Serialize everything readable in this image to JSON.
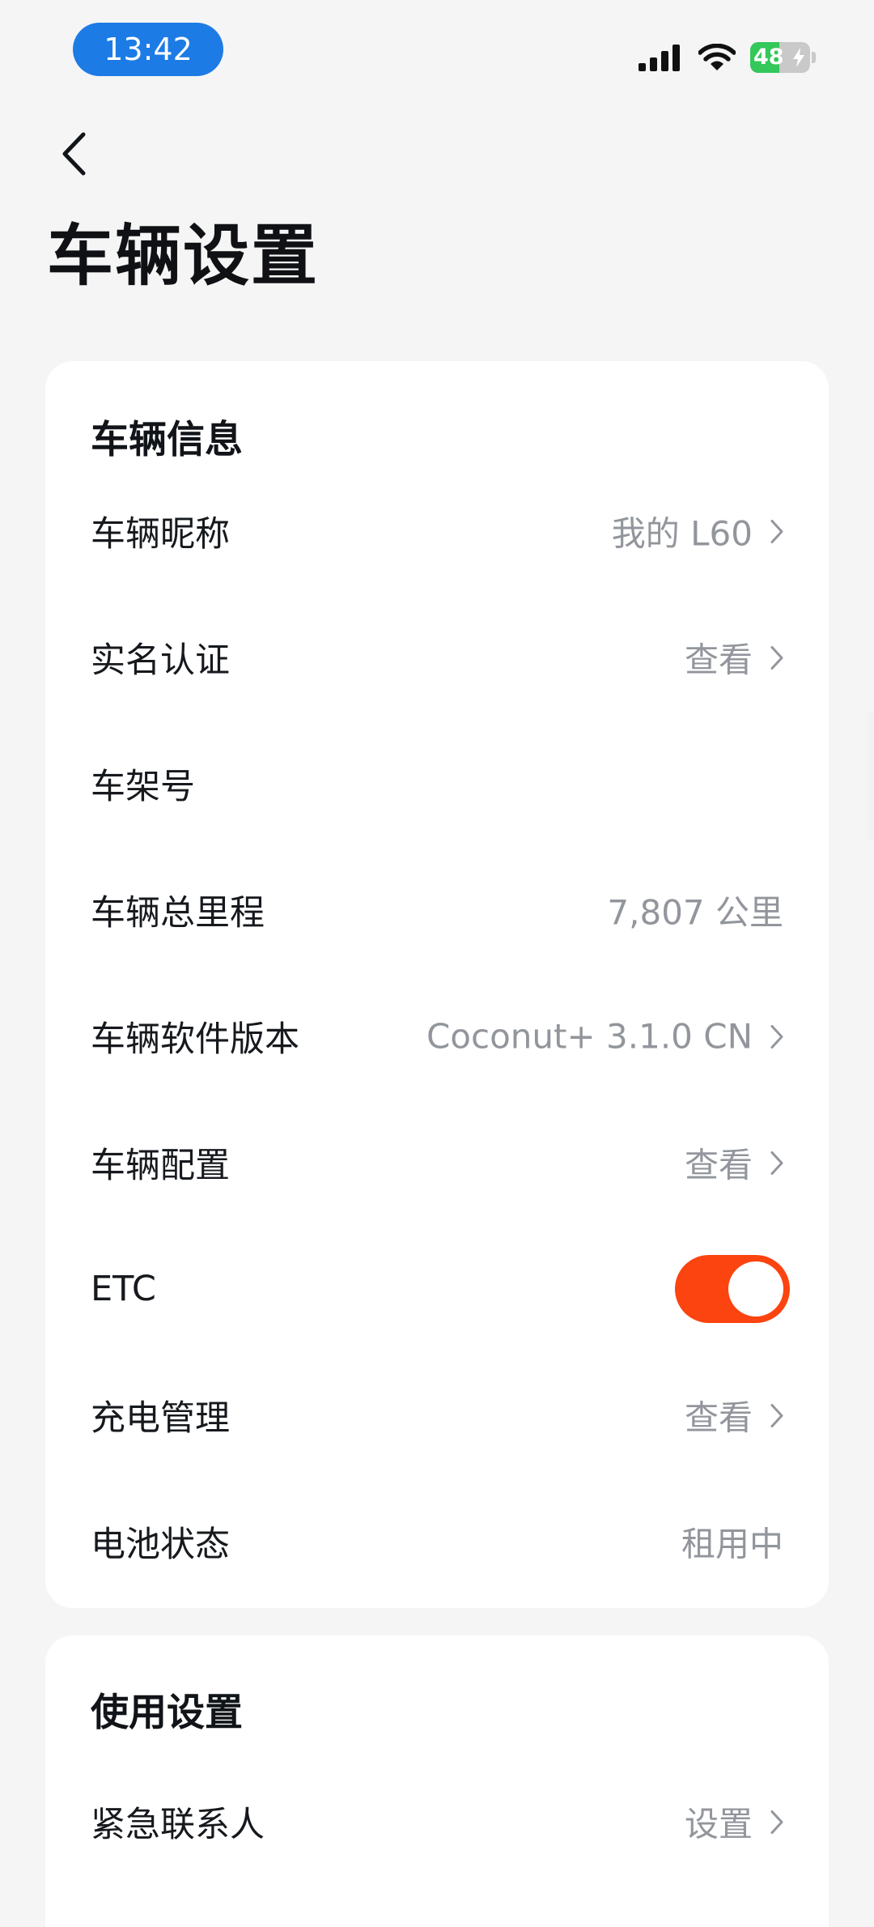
{
  "status_bar": {
    "time": "13:42",
    "battery_level": "48",
    "battery_fraction": 0.48
  },
  "page": {
    "title": "车辆设置"
  },
  "vehicle_info": {
    "title": "车辆信息",
    "rows": [
      {
        "label": "车辆昵称",
        "value": "我的 L60",
        "has_chevron": true
      },
      {
        "label": "实名认证",
        "value": "查看",
        "has_chevron": true
      },
      {
        "label": "车架号",
        "value": "",
        "has_chevron": false
      },
      {
        "label": "车辆总里程",
        "value": "7,807 公里",
        "has_chevron": false
      },
      {
        "label": "车辆软件版本",
        "value": "Coconut+ 3.1.0 CN",
        "has_chevron": true
      },
      {
        "label": "车辆配置",
        "value": "查看",
        "has_chevron": true
      },
      {
        "label": "ETC",
        "toggle_on": true
      },
      {
        "label": "充电管理",
        "value": "查看",
        "has_chevron": true
      },
      {
        "label": "电池状态",
        "value": "租用中",
        "has_chevron": false
      }
    ]
  },
  "usage_settings": {
    "title": "使用设置",
    "rows": [
      {
        "label": "紧急联系人",
        "value": "设置",
        "has_chevron": true
      }
    ]
  },
  "colors": {
    "background": "#f5f5f5",
    "card": "#ffffff",
    "accent_toggle": "#fb4410",
    "time_pill": "#1d7be5",
    "secondary_text": "#92969c",
    "battery_green": "#34c759"
  },
  "icons": [
    "back-arrow-icon",
    "signal-icon",
    "wifi-icon",
    "battery-icon",
    "charging-bolt-icon",
    "chevron-right-icon"
  ]
}
